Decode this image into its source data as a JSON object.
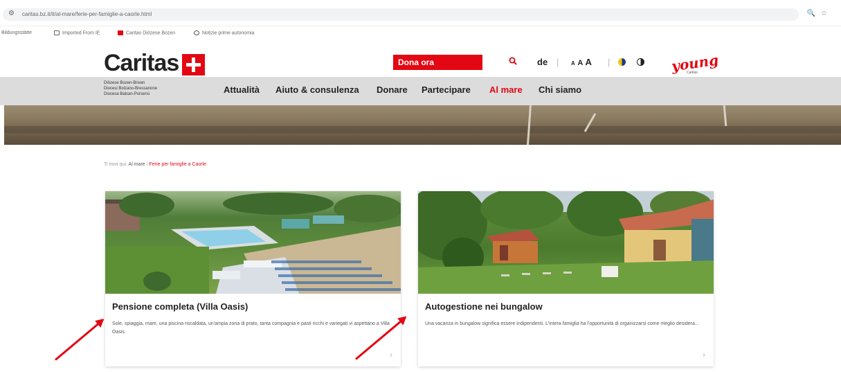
{
  "browser": {
    "url": "caritas.bz.it/it/al-mare/ferie-per-famiglie-a-caorle.html",
    "bookmarks": [
      "Bildungsstätte",
      "Imported From IE",
      "Caritas Diözese Bozen",
      "Notizie prime autonomia"
    ]
  },
  "header": {
    "logo_text": "Caritas",
    "donate_label": "Dona ora",
    "lang_label": "de",
    "font_small": "A",
    "font_mid": "A",
    "font_large": "A",
    "young_label": "young",
    "young_sub": "Caritas"
  },
  "diocese": {
    "line1": "Diözese Bozen-Brixen",
    "line2": "Diocesi Bolzano-Bressanone",
    "line3": "Diocesa Balsan-Porsenù"
  },
  "nav": {
    "items": [
      "Attualità",
      "Aiuto & consulenza",
      "Donare",
      "Partecipare",
      "Al mare",
      "Chi siamo"
    ],
    "active": "Al mare"
  },
  "breadcrumb": {
    "prefix": "Ti trovi qui:",
    "link": "Al mare",
    "sep": "/",
    "current": "Ferie per famiglie a Caorle"
  },
  "cards": [
    {
      "title": "Pensione completa (Villa Oasis)",
      "text": "Sole, spiaggia, mare, una piscina riscaldata, un'ampia zona di prato, tanta compagnia e pasti ricchi e variegati vi aspettano a Villa Oasis.",
      "chevron": "›"
    },
    {
      "title": "Autogestione nei bungalow",
      "text": "Una vacanza in bungalow significa essere indipendenti. L'intera famiglia ha l'opportunità di organizzarsi come meglio desidera...",
      "chevron": "›"
    }
  ],
  "colors": {
    "accent": "#e30613",
    "nav_bg": "#dcdcdc"
  },
  "icons": {
    "search": "search-icon",
    "contrast_color": "color-contrast-icon",
    "contrast_bw": "bw-contrast-icon"
  }
}
